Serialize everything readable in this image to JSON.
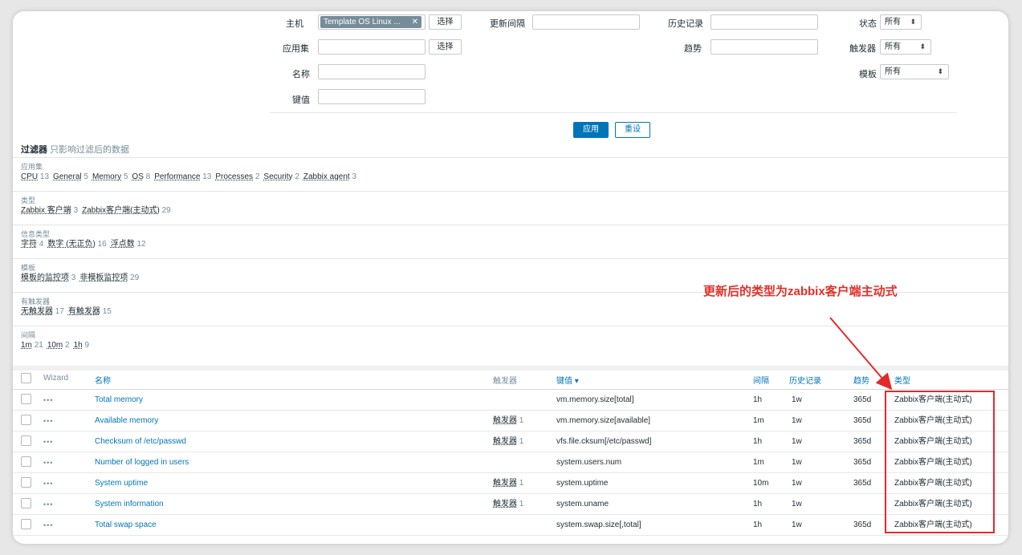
{
  "filter": {
    "host_label": "主机",
    "host_tag": "Template OS Linux ...",
    "host_tag_close": "✕",
    "select_label": "选择",
    "appset_label": "应用集",
    "name_label": "名称",
    "key_label": "键值",
    "interval_label": "更新间隔",
    "history_label": "历史记录",
    "trend_label": "趋势",
    "status_label": "状态",
    "status_value": "所有",
    "trigger_label": "触发器",
    "trigger_value": "所有",
    "template_label": "模板",
    "template_value": "所有",
    "apply_label": "应用",
    "reset_label": "重设",
    "select_arrow": "⬍"
  },
  "subfilter": {
    "title": "过滤器",
    "note": "只影响过滤后的数据",
    "groups": [
      {
        "title": "应用集",
        "items": [
          {
            "label": "CPU",
            "count": "13"
          },
          {
            "label": "General",
            "count": "5"
          },
          {
            "label": "Memory",
            "count": "5"
          },
          {
            "label": "OS",
            "count": "8"
          },
          {
            "label": "Performance",
            "count": "13"
          },
          {
            "label": "Processes",
            "count": "2"
          },
          {
            "label": "Security",
            "count": "2"
          },
          {
            "label": "Zabbix agent",
            "count": "3"
          }
        ]
      },
      {
        "title": "类型",
        "items": [
          {
            "label": "Zabbix 客户端",
            "count": "3"
          },
          {
            "label": "Zabbix客户端(主动式)",
            "count": "29"
          }
        ]
      },
      {
        "title": "信息类型",
        "items": [
          {
            "label": "字符",
            "count": "4"
          },
          {
            "label": "数字 (无正负)",
            "count": "16"
          },
          {
            "label": "浮点数",
            "count": "12"
          }
        ]
      },
      {
        "title": "模板",
        "items": [
          {
            "label": "模板的监控项",
            "count": "3"
          },
          {
            "label": "非模板监控项",
            "count": "29"
          }
        ]
      },
      {
        "title": "有触发器",
        "items": [
          {
            "label": "无触发器",
            "count": "17"
          },
          {
            "label": "有触发器",
            "count": "15"
          }
        ]
      },
      {
        "title": "间隔",
        "items": [
          {
            "label": "1m",
            "count": "21"
          },
          {
            "label": "10m",
            "count": "2"
          },
          {
            "label": "1h",
            "count": "9"
          }
        ]
      }
    ]
  },
  "table": {
    "headers": {
      "wizard": "Wizard",
      "name": "名称",
      "triggers": "触发器",
      "key": "键值 ▾",
      "interval": "间隔",
      "history": "历史记录",
      "trends": "趋势",
      "type": "类型"
    },
    "dots": "•••",
    "rows": [
      {
        "name": "Total memory",
        "trigger": "",
        "trigger_count": "",
        "key": "vm.memory.size[total]",
        "interval": "1h",
        "history": "1w",
        "trends": "365d",
        "type": "Zabbix客户端(主动式)"
      },
      {
        "name": "Available memory",
        "trigger": "触发器",
        "trigger_count": "1",
        "key": "vm.memory.size[available]",
        "interval": "1m",
        "history": "1w",
        "trends": "365d",
        "type": "Zabbix客户端(主动式)"
      },
      {
        "name": "Checksum of /etc/passwd",
        "trigger": "触发器",
        "trigger_count": "1",
        "key": "vfs.file.cksum[/etc/passwd]",
        "interval": "1h",
        "history": "1w",
        "trends": "365d",
        "type": "Zabbix客户端(主动式)"
      },
      {
        "name": "Number of logged in users",
        "trigger": "",
        "trigger_count": "",
        "key": "system.users.num",
        "interval": "1m",
        "history": "1w",
        "trends": "365d",
        "type": "Zabbix客户端(主动式)"
      },
      {
        "name": "System uptime",
        "trigger": "触发器",
        "trigger_count": "1",
        "key": "system.uptime",
        "interval": "10m",
        "history": "1w",
        "trends": "365d",
        "type": "Zabbix客户端(主动式)"
      },
      {
        "name": "System information",
        "trigger": "触发器",
        "trigger_count": "1",
        "key": "system.uname",
        "interval": "1h",
        "history": "1w",
        "trends": "",
        "type": "Zabbix客户端(主动式)"
      },
      {
        "name": "Total swap space",
        "trigger": "",
        "trigger_count": "",
        "key": "system.swap.size[,total]",
        "interval": "1h",
        "history": "1w",
        "trends": "365d",
        "type": "Zabbix客户端(主动式)"
      }
    ]
  },
  "annotation": {
    "text": "更新后的类型为zabbix客户端主动式",
    "color": "#e2312a"
  },
  "colors": {
    "link": "#0275b8",
    "muted": "#768d99",
    "highlight": "#e32a2a"
  }
}
